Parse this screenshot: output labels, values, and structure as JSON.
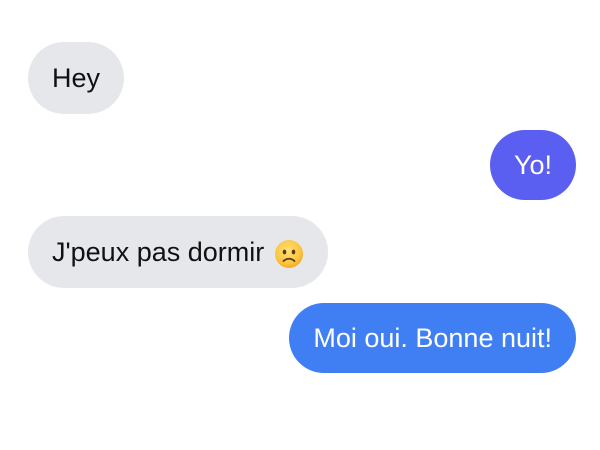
{
  "messages": [
    {
      "direction": "incoming",
      "text": "Hey"
    },
    {
      "direction": "outgoing",
      "text": "Yo!",
      "color": "#5b5ff1"
    },
    {
      "direction": "incoming",
      "text": "J'peux pas dormir",
      "emoji": "worried-face-icon"
    },
    {
      "direction": "outgoing",
      "text": "Moi oui. Bonne nuit!",
      "color": "#3f7ff3"
    }
  ],
  "colors": {
    "incoming_bubble": "#e6e7eb",
    "background": "#ffffff"
  }
}
